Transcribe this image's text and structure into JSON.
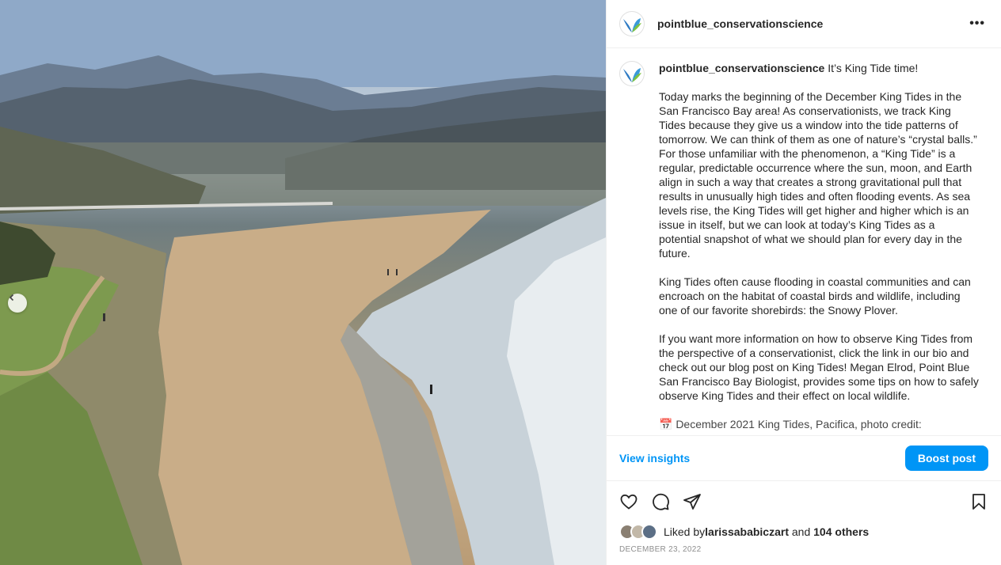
{
  "account": {
    "username": "pointblue_conservationscience"
  },
  "header": {
    "more_label": "•••"
  },
  "caption": {
    "username": "pointblue_conservationscience",
    "title": "It’s King Tide time!",
    "paragraphs": [
      "Today marks the beginning of the December King Tides in the San Francisco Bay area! As conservationists, we track King Tides because they give us a window into the tide patterns of tomorrow. We can think of them as one of nature’s “crystal balls.” For those unfamiliar with the phenomenon, a “King Tide” is a regular, predictable occurrence where the sun, moon, and Earth align in such a way that creates a strong gravitational pull that results in unusually high tides and often flooding events. As sea levels rise, the King Tides will get higher and higher which is an issue in itself, but we can look at today’s King Tides as a potential snapshot of what we should plan for every day in the future.",
      "King Tides often cause flooding in coastal communities and can encroach on the habitat of coastal birds and wildlife, including one of our favorite shorebirds: the Snowy Plover.",
      "If you want more information on how to observe King Tides from the perspective of a conservationist, click the link in our bio and check out our blog post on King Tides! Megan Elrod, Point Blue San Francisco Bay Biologist, provides some tips on how to safely observe King Tides and their effect on local wildlife."
    ],
    "partial_line": "📅 December 2021 King Tides, Pacifica, photo credit: "
  },
  "insights": {
    "view_label": "View insights",
    "boost_label": "Boost post"
  },
  "icons": {
    "like": "heart-icon",
    "comment": "comment-icon",
    "share": "send-icon",
    "save": "bookmark-icon",
    "carousel_prev": "chevron-left-icon"
  },
  "likes": {
    "prefix": "Liked by ",
    "user": "larissababiczart",
    "and": " and ",
    "others": "104 others"
  },
  "date": "DECEMBER 23, 2022",
  "colors": {
    "accent": "#0095f6",
    "text": "#262626",
    "muted": "#8e8e8e"
  }
}
